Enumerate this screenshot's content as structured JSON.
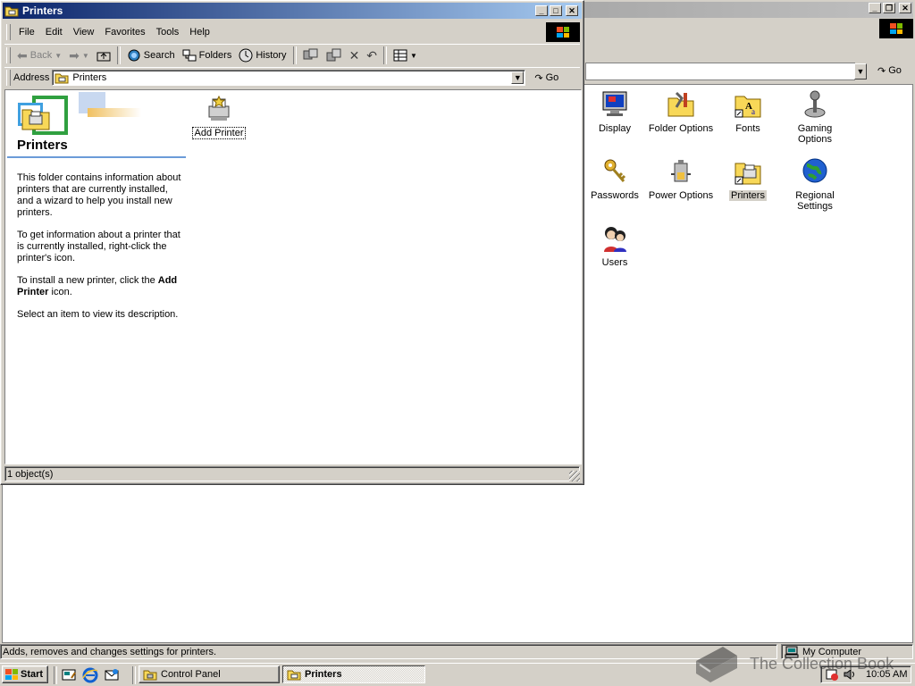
{
  "bg_window": {
    "go_label": "Go",
    "icons": [
      {
        "label": "Display",
        "icon": "display-icon"
      },
      {
        "label": "Folder Options",
        "icon": "folder-options-icon"
      },
      {
        "label": "Fonts",
        "icon": "fonts-icon"
      },
      {
        "label": "Gaming Options",
        "icon": "gaming-options-icon"
      },
      {
        "label": "Passwords",
        "icon": "passwords-icon"
      },
      {
        "label": "Power Options",
        "icon": "power-options-icon"
      },
      {
        "label": "Printers",
        "icon": "printers-icon",
        "selected": true
      },
      {
        "label": "Regional Settings",
        "icon": "regional-settings-icon"
      },
      {
        "label": "Users",
        "icon": "users-icon"
      }
    ],
    "status_text": "Adds, removes and changes settings for printers.",
    "status_location": "My Computer"
  },
  "printers_window": {
    "title": "Printers",
    "menu": [
      "File",
      "Edit",
      "View",
      "Favorites",
      "Tools",
      "Help"
    ],
    "toolbar": {
      "back": "Back",
      "search": "Search",
      "folders": "Folders",
      "history": "History"
    },
    "address_label": "Address",
    "address_value": "Printers",
    "go_label": "Go",
    "panel_title": "Printers",
    "panel_p1": "This folder contains information about printers that are currently installed, and a wizard to help you install new printers.",
    "panel_p2": "To get information about a printer that is currently installed, right-click the printer's icon.",
    "panel_p3_pre": "To install a new printer, click the ",
    "panel_p3_bold": "Add Printer",
    "panel_p3_post": " icon.",
    "panel_p4": "Select an item to view its description.",
    "item_label": "Add Printer",
    "status": "1 object(s)"
  },
  "taskbar": {
    "start_label": "Start",
    "tasks": [
      {
        "label": "Control Panel",
        "active": false
      },
      {
        "label": "Printers",
        "active": true
      }
    ],
    "clock": "10:05 AM"
  },
  "watermark": "The Collection Book"
}
